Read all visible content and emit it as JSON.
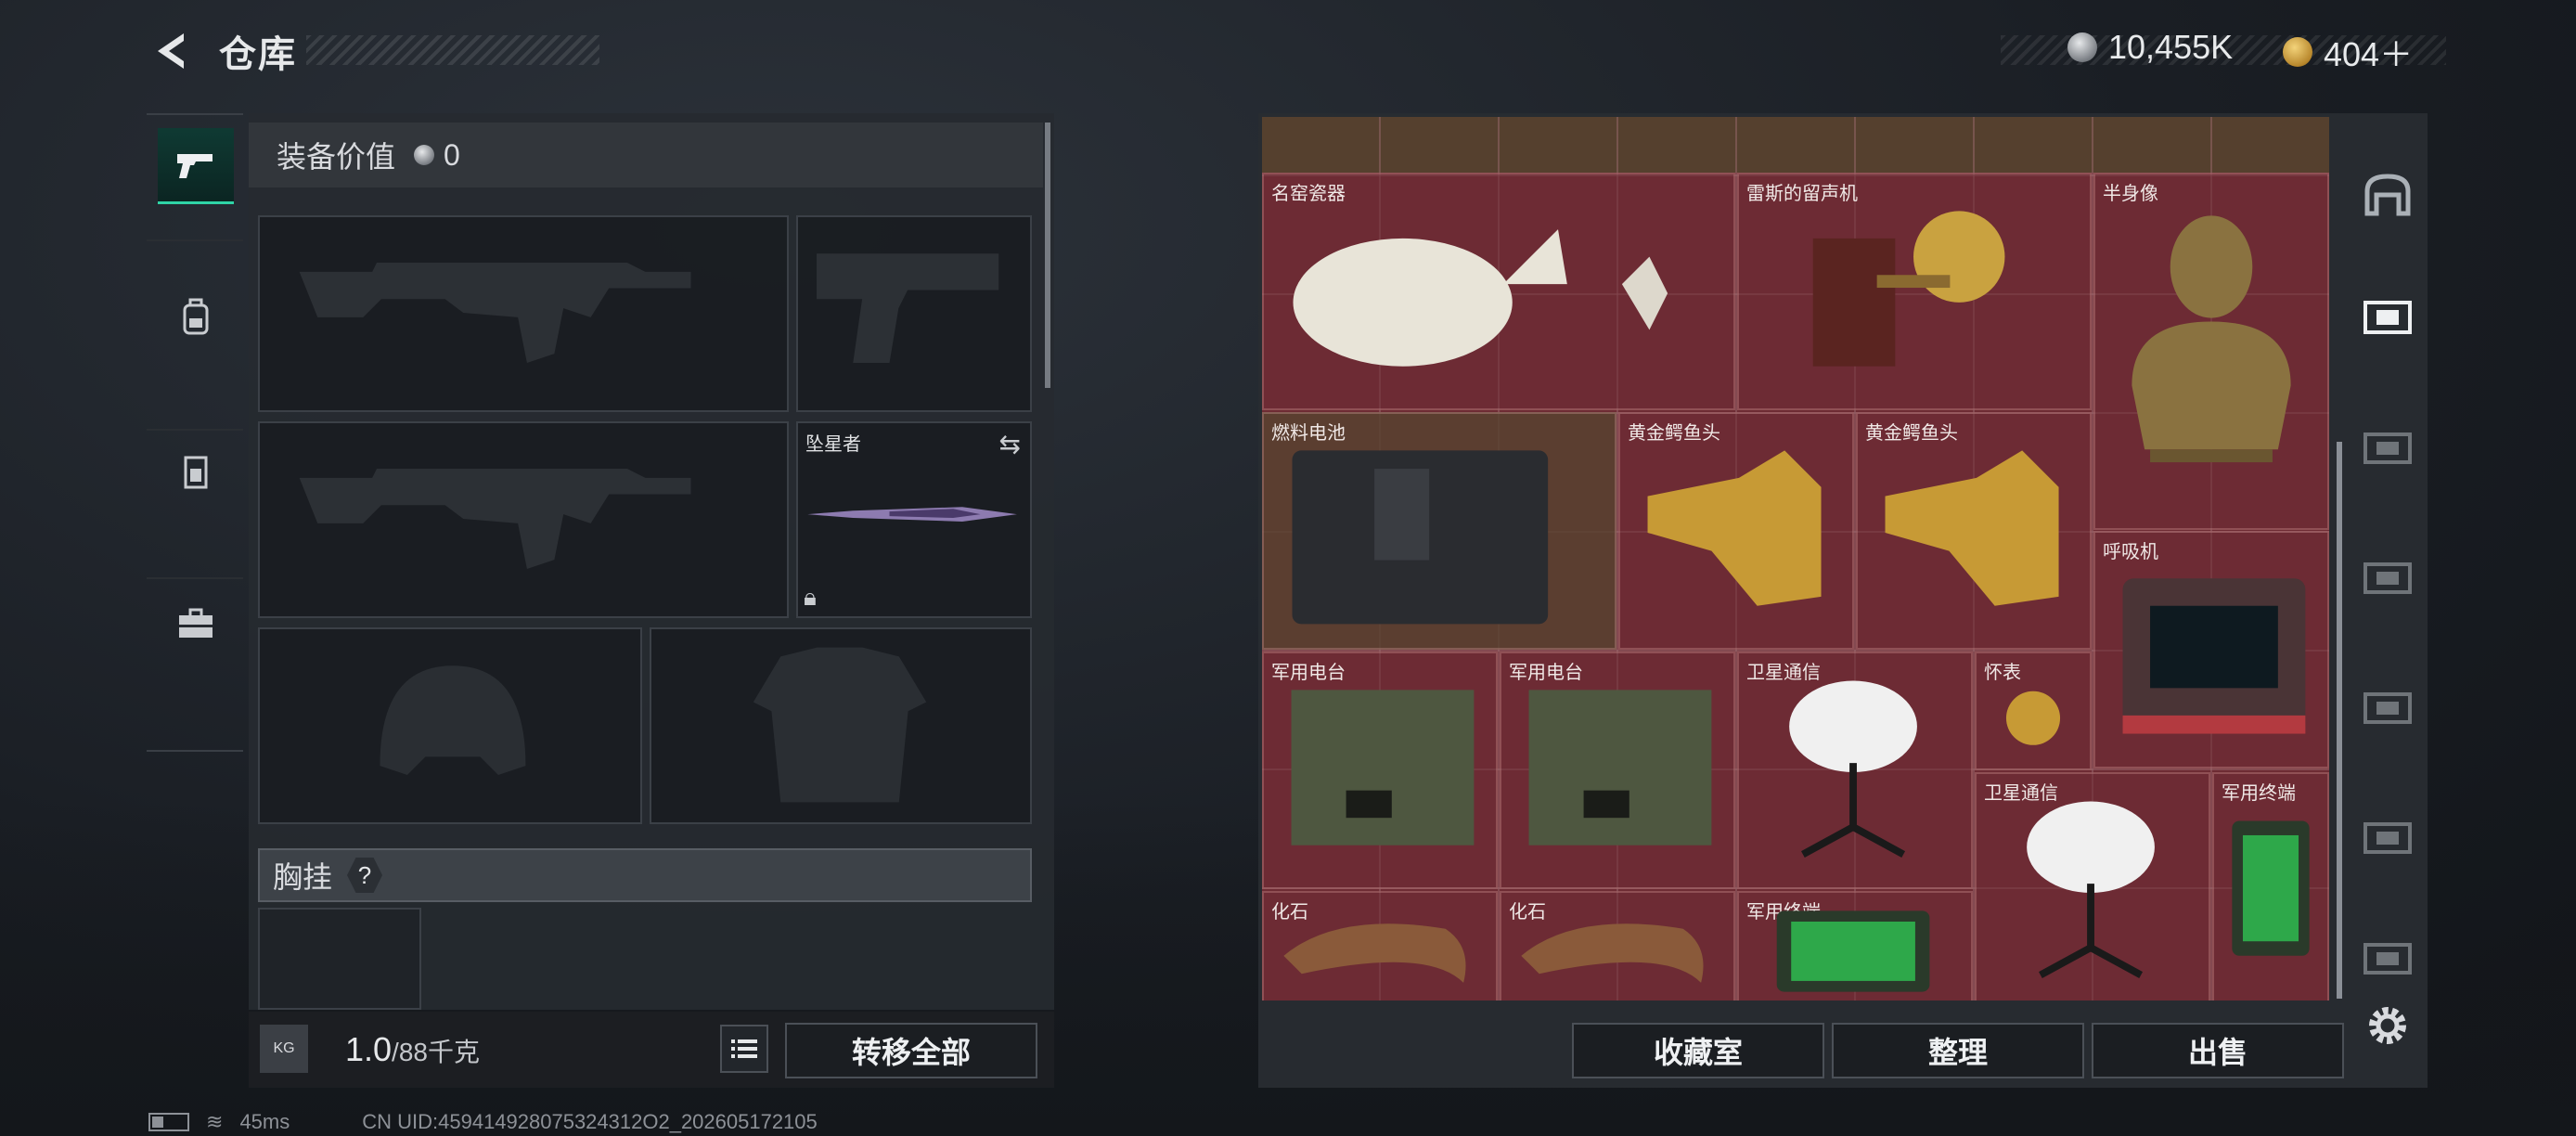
{
  "header": {
    "title": "仓库",
    "silver_amount": "10,455K",
    "gold_amount": "404＋"
  },
  "left_tabs": [
    {
      "name": "weapons",
      "icon": "pistol-icon",
      "active": true
    },
    {
      "name": "backpack",
      "icon": "backpack-icon",
      "active": false
    },
    {
      "name": "vest",
      "icon": "vest-icon",
      "active": false
    },
    {
      "name": "case",
      "icon": "briefcase-icon",
      "active": false
    }
  ],
  "loadout": {
    "value_label": "装备价值",
    "value_amount": "0",
    "melee_label": "坠星者",
    "chest_label": "胸挂",
    "chest_help": "?"
  },
  "bottom": {
    "weight_current": "1.0",
    "weight_max": "/88千克",
    "weight_icon_text": "KG",
    "transfer_all": "转移全部"
  },
  "stash": {
    "items": [
      {
        "name": "名窑瓷器",
        "tint": "red"
      },
      {
        "name": "雷斯的留声机",
        "tint": "red"
      },
      {
        "name": "半身像",
        "tint": "red"
      },
      {
        "name": "燃料电池",
        "tint": "brown"
      },
      {
        "name": "黄金鳄鱼头",
        "tint": "red"
      },
      {
        "name": "黄金鳄鱼头",
        "tint": "red"
      },
      {
        "name": "呼吸机",
        "tint": "red"
      },
      {
        "name": "军用电台",
        "tint": "red"
      },
      {
        "name": "军用电台",
        "tint": "red"
      },
      {
        "name": "卫星通信",
        "tint": "red"
      },
      {
        "name": "怀表",
        "tint": "red"
      },
      {
        "name": "卫星通信",
        "tint": "red"
      },
      {
        "name": "军用终端",
        "tint": "red"
      },
      {
        "name": "化石",
        "tint": "red"
      },
      {
        "name": "化石",
        "tint": "red"
      },
      {
        "name": "军用终端",
        "tint": "red"
      }
    ],
    "buttons": {
      "collection": "收藏室",
      "sort": "整理",
      "sell": "出售"
    }
  },
  "right_tabs": [
    "warehouse-icon",
    "stash-I-icon",
    "stash-IV-icon",
    "stash-IV-icon",
    "stash-III-icon",
    "stash-IV-icon",
    "stash-IV-icon"
  ],
  "status": {
    "ping": "45ms",
    "uid": "CN UID:459414928075324312O2_202605172105"
  },
  "colors": {
    "accent_green": "#2fd4a6",
    "grid_red": "#6e2c34"
  }
}
